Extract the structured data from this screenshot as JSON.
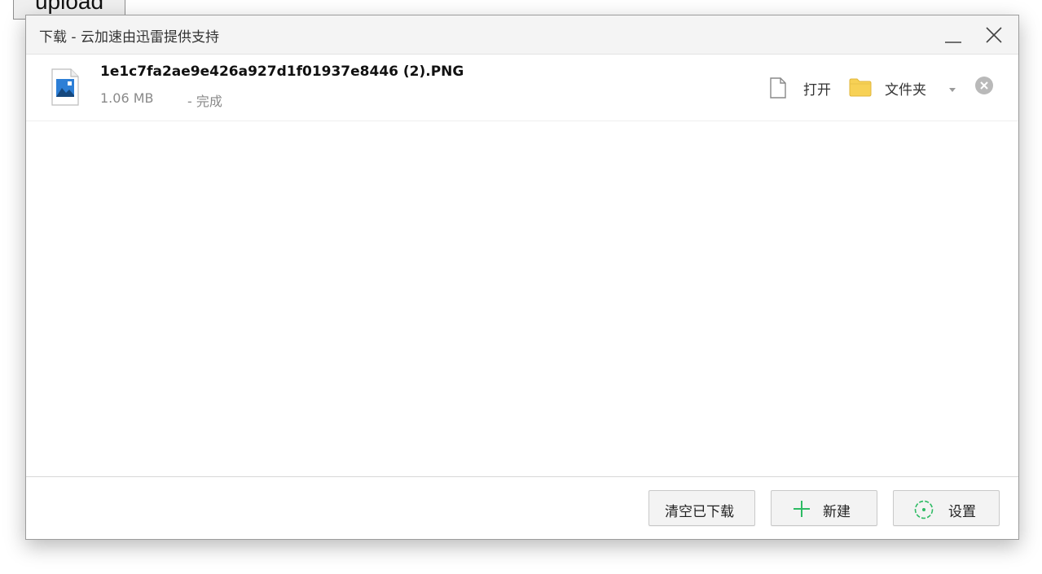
{
  "page": {
    "upload_button_label": "upload"
  },
  "dialog": {
    "title": "下载 - 云加速由迅雷提供支持",
    "minimize_icon": "minimize-icon",
    "close_icon": "close-icon"
  },
  "download": {
    "file_name": "1e1c7fa2ae9e426a927d1f01937e8446 (2).PNG",
    "file_size": "1.06 MB",
    "status": "- 完成",
    "file_type_icon": "image-file-icon",
    "open_label": "打开",
    "open_icon": "document-icon",
    "folder_label": "文件夹",
    "folder_icon": "folder-icon",
    "more_icon": "dropdown-arrow-icon",
    "remove_icon": "remove-circle-icon"
  },
  "footer": {
    "clear_label": "清空已下载",
    "new_label": "新建",
    "new_icon": "plus-icon",
    "settings_label": "设置",
    "settings_icon": "gear-icon"
  },
  "colors": {
    "accent_green": "#2dbb63",
    "folder_yellow": "#f7d155",
    "image_blue": "#2d7fd6"
  }
}
